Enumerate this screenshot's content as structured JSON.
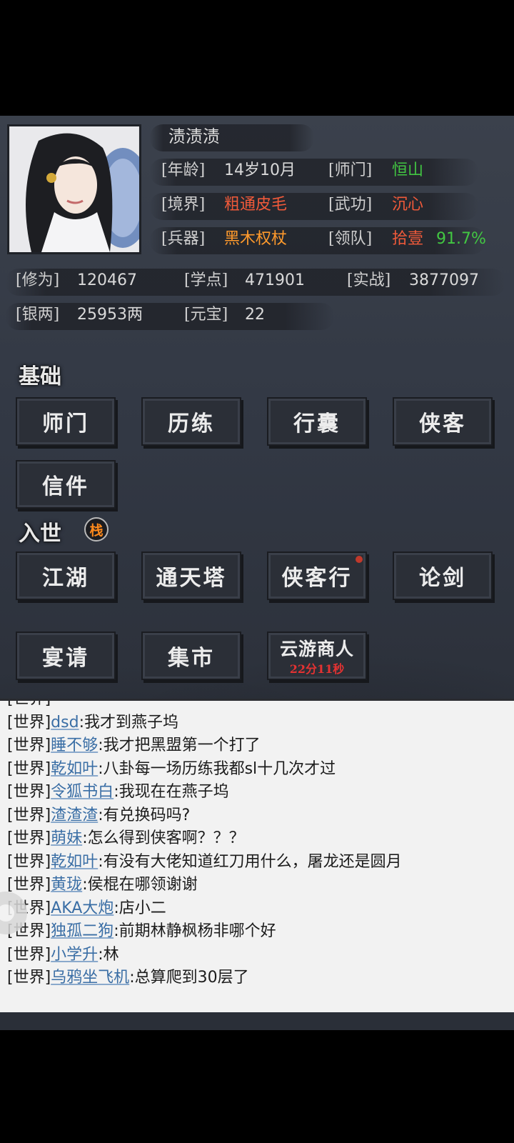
{
  "profile": {
    "name": "渍渍渍",
    "age_label": "[年龄]",
    "age": "14岁10月",
    "school_label": "[师门]",
    "school": "恒山",
    "realm_label": "[境界]",
    "realm": "粗通皮毛",
    "skill_label": "[武功]",
    "skill": "沉心",
    "weapon_label": "[兵器]",
    "weapon": "黑木权杖",
    "team_label": "[领队]",
    "team": "拾壹",
    "team_pct": "91.7%"
  },
  "stats": {
    "cultivation_label": "[修为]",
    "cultivation": "120467",
    "points_label": "[学点]",
    "points": "471901",
    "combat_label": "[实战]",
    "combat": "3877097",
    "silver_label": "[银两]",
    "silver": "25953两",
    "ingot_label": "[元宝]",
    "ingot": "22"
  },
  "basic": {
    "title": "基础",
    "buttons": [
      "师门",
      "历练",
      "行囊",
      "侠客",
      "信件"
    ]
  },
  "world": {
    "title": "入世",
    "badge": "栈",
    "buttons": [
      "江湖",
      "通天塔",
      "侠客行",
      "论剑",
      "宴请",
      "集市"
    ],
    "merchant": "云游商人",
    "merchant_timer": "22分11秒"
  },
  "chat": [
    {
      "chan": "[世界]",
      "user": "dsd",
      "msg": ":我才到燕子坞"
    },
    {
      "chan": "[世界]",
      "user": "睡不够",
      "msg": ":我才把黑盟第一个打了"
    },
    {
      "chan": "[世界]",
      "user": "乾如叶",
      "msg": ":八卦每一场历练我都sl十几次才过"
    },
    {
      "chan": "[世界]",
      "user": "令狐书白",
      "msg": ":我现在在燕子坞"
    },
    {
      "chan": "[世界]",
      "user": "渣渣渣",
      "msg": ":有兑换码吗?"
    },
    {
      "chan": "[世界]",
      "user": "萌妹",
      "msg": ":怎么得到侠客啊？？？"
    },
    {
      "chan": "[世界]",
      "user": "乾如叶",
      "msg": ":有没有大佬知道红刀用什么，屠龙还是圆月"
    },
    {
      "chan": "[世界]",
      "user": "黄珑",
      "msg": ":侯棍在哪领谢谢"
    },
    {
      "chan": "[世界]",
      "user": "AKA大炮",
      "msg": ":店小二"
    },
    {
      "chan": "[世界]",
      "user": "独孤二狗",
      "msg": ":前期林静枫杨非哪个好"
    },
    {
      "chan": "[世界]",
      "user": "小学升",
      "msg": ":林"
    },
    {
      "chan": "[世界]",
      "user": "乌鸦坐飞机",
      "msg": ":总算爬到30层了"
    }
  ],
  "colors": {
    "green": "#42c742",
    "red": "#f15a3a",
    "orange": "#ff9a2c",
    "timer_red": "#e43232"
  }
}
